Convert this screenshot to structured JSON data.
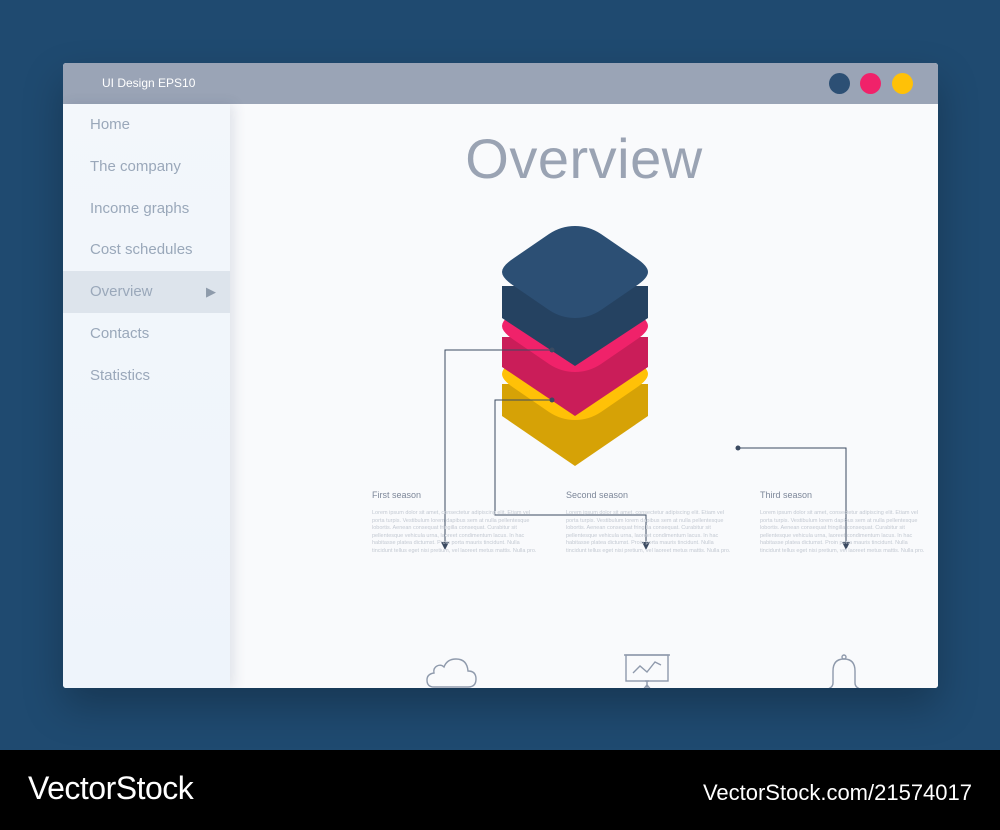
{
  "window": {
    "title": "UI Design EPS10",
    "controls": [
      {
        "name": "minimize",
        "color": "#2c4f74"
      },
      {
        "name": "maximize",
        "color": "#f0226a"
      },
      {
        "name": "close",
        "color": "#ffc107"
      }
    ]
  },
  "sidebar": {
    "items": [
      {
        "label": "Home",
        "active": false
      },
      {
        "label": "The company",
        "active": false
      },
      {
        "label": "Income graphs",
        "active": false
      },
      {
        "label": "Cost schedules",
        "active": false
      },
      {
        "label": "Overview",
        "active": true,
        "indicator": "▶"
      },
      {
        "label": "Contacts",
        "active": false
      },
      {
        "label": "Statistics",
        "active": false
      }
    ]
  },
  "main": {
    "title": "Overview",
    "layers": [
      {
        "name": "top",
        "color": "#2c4f74"
      },
      {
        "name": "middle",
        "color": "#f0226a"
      },
      {
        "name": "bottom",
        "color": "#ffc107"
      }
    ],
    "seasons": [
      {
        "label": "First season",
        "icon": "cloud-icon",
        "text": "Lorem ipsum dolor sit amet, consectetur adipiscing elit. Etiam vel porta turpis. Vestibulum lorem dapibus sem at nulla pellentesque lobortis. Aenean consequat fringilla consequat. Curabitur sit pellentesque vehicula urna, laoreet condimentum lacus. In hac habitasse platea dictumst. Proin porta mauris tincidunt. Nulla tincidunt tellus eget nisi pretium, vel laoreet metus mattis. Nulla pro."
      },
      {
        "label": "Second season",
        "icon": "presentation-board-icon",
        "text": "Lorem ipsum dolor sit amet, consectetur adipiscing elit. Etiam vel porta turpis. Vestibulum lorem dapibus sem at nulla pellentesque lobortis. Aenean consequat fringilla consequat. Curabitur sit pellentesque vehicula urna, laoreet condimentum lacus. In hac habitasse platea dictumst. Proin porta mauris tincidunt. Nulla tincidunt tellus eget nisi pretium, vel laoreet metus mattis. Nulla pro."
      },
      {
        "label": "Third season",
        "icon": "bell-icon",
        "text": "Lorem ipsum dolor sit amet, consectetur adipiscing elit. Etiam vel porta turpis. Vestibulum lorem dapibus sem at nulla pellentesque lobortis. Aenean consequat fringilla consequat. Curabitur sit pellentesque vehicula urna, laoreet condimentum lacus. In hac habitasse platea dictumst. Proin porta mauris tincidunt. Nulla tincidunt tellus eget nisi pretium, vel laoreet metus mattis. Nulla pro."
      }
    ]
  },
  "watermark": {
    "brand": "VectorStock",
    "id_text": "VectorStock.com/21574017"
  }
}
